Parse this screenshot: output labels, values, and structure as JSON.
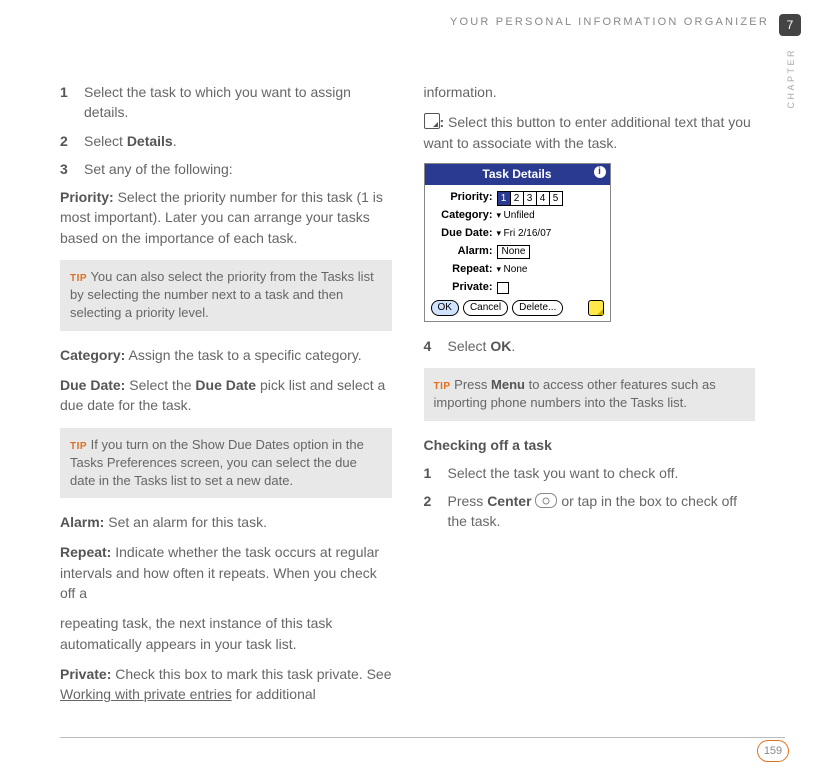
{
  "header": {
    "title": "YOUR PERSONAL INFORMATION ORGANIZER",
    "chapter_number": "7",
    "chapter_label": "CHAPTER"
  },
  "left": {
    "steps": [
      {
        "n": "1",
        "text": "Select the task to which you want to assign details."
      },
      {
        "n": "2",
        "text_pre": "Select ",
        "bold": "Details",
        "text_post": "."
      },
      {
        "n": "3",
        "text": "Set any of the following:"
      }
    ],
    "priority": {
      "label": "Priority:",
      "text": " Select the priority number for this task (1 is most important). Later you can arrange your tasks based on the importance of each task."
    },
    "tip1": {
      "label": "TIP",
      "text": " You can also select the priority from the Tasks list by selecting the number next to a task and then selecting a priority level."
    },
    "category": {
      "label": "Category:",
      "text": " Assign the task to a specific category."
    },
    "duedate": {
      "label": "Due Date:",
      "pre": " Select the ",
      "bold": "Due Date",
      "post": " pick list and select a due date for the task."
    },
    "tip2": {
      "label": "TIP",
      "text": " If you turn on the Show Due Dates option in the Tasks Preferences screen, you can select the due date in the Tasks list to set a new date."
    },
    "alarm": {
      "label": "Alarm:",
      "text": " Set an alarm for this task."
    },
    "repeat": {
      "label": "Repeat:",
      "text": " Indicate whether the task occurs at regular intervals and how often it repeats. When you check off a"
    }
  },
  "right": {
    "repeat_cont": "repeating task, the next instance of this task automatically appears in your task list.",
    "private": {
      "label": "Private:",
      "pre": " Check this box to mark this task private. See ",
      "link": "Working with private entries",
      "post": " for additional information."
    },
    "note": {
      "colon": ":",
      "text": " Select this button to enter additional text that you want to associate with the task."
    },
    "device": {
      "title": "Task Details",
      "priority_label": "Priority:",
      "priority_vals": [
        "1",
        "2",
        "3",
        "4",
        "5"
      ],
      "category_label": "Category:",
      "category_val": "Unfiled",
      "due_label": "Due Date:",
      "due_val": "Fri 2/16/07",
      "alarm_label": "Alarm:",
      "alarm_val": "None",
      "repeat_label": "Repeat:",
      "repeat_val": "None",
      "private_label": "Private:",
      "ok": "OK",
      "cancel": "Cancel",
      "delete": "Delete..."
    },
    "step4": {
      "n": "4",
      "pre": "Select ",
      "bold": "OK",
      "post": "."
    },
    "tip3": {
      "label": "TIP",
      "pre": " Press ",
      "bold": "Menu",
      "post": " to access other features such as importing phone numbers into the Tasks list."
    },
    "section": "Checking off a task",
    "csteps": [
      {
        "n": "1",
        "text": "Select the task you want to check off."
      },
      {
        "n": "2",
        "pre": "Press ",
        "bold": "Center",
        "post": " or tap in the box to check off the task."
      }
    ]
  },
  "footer": {
    "page": "159"
  }
}
